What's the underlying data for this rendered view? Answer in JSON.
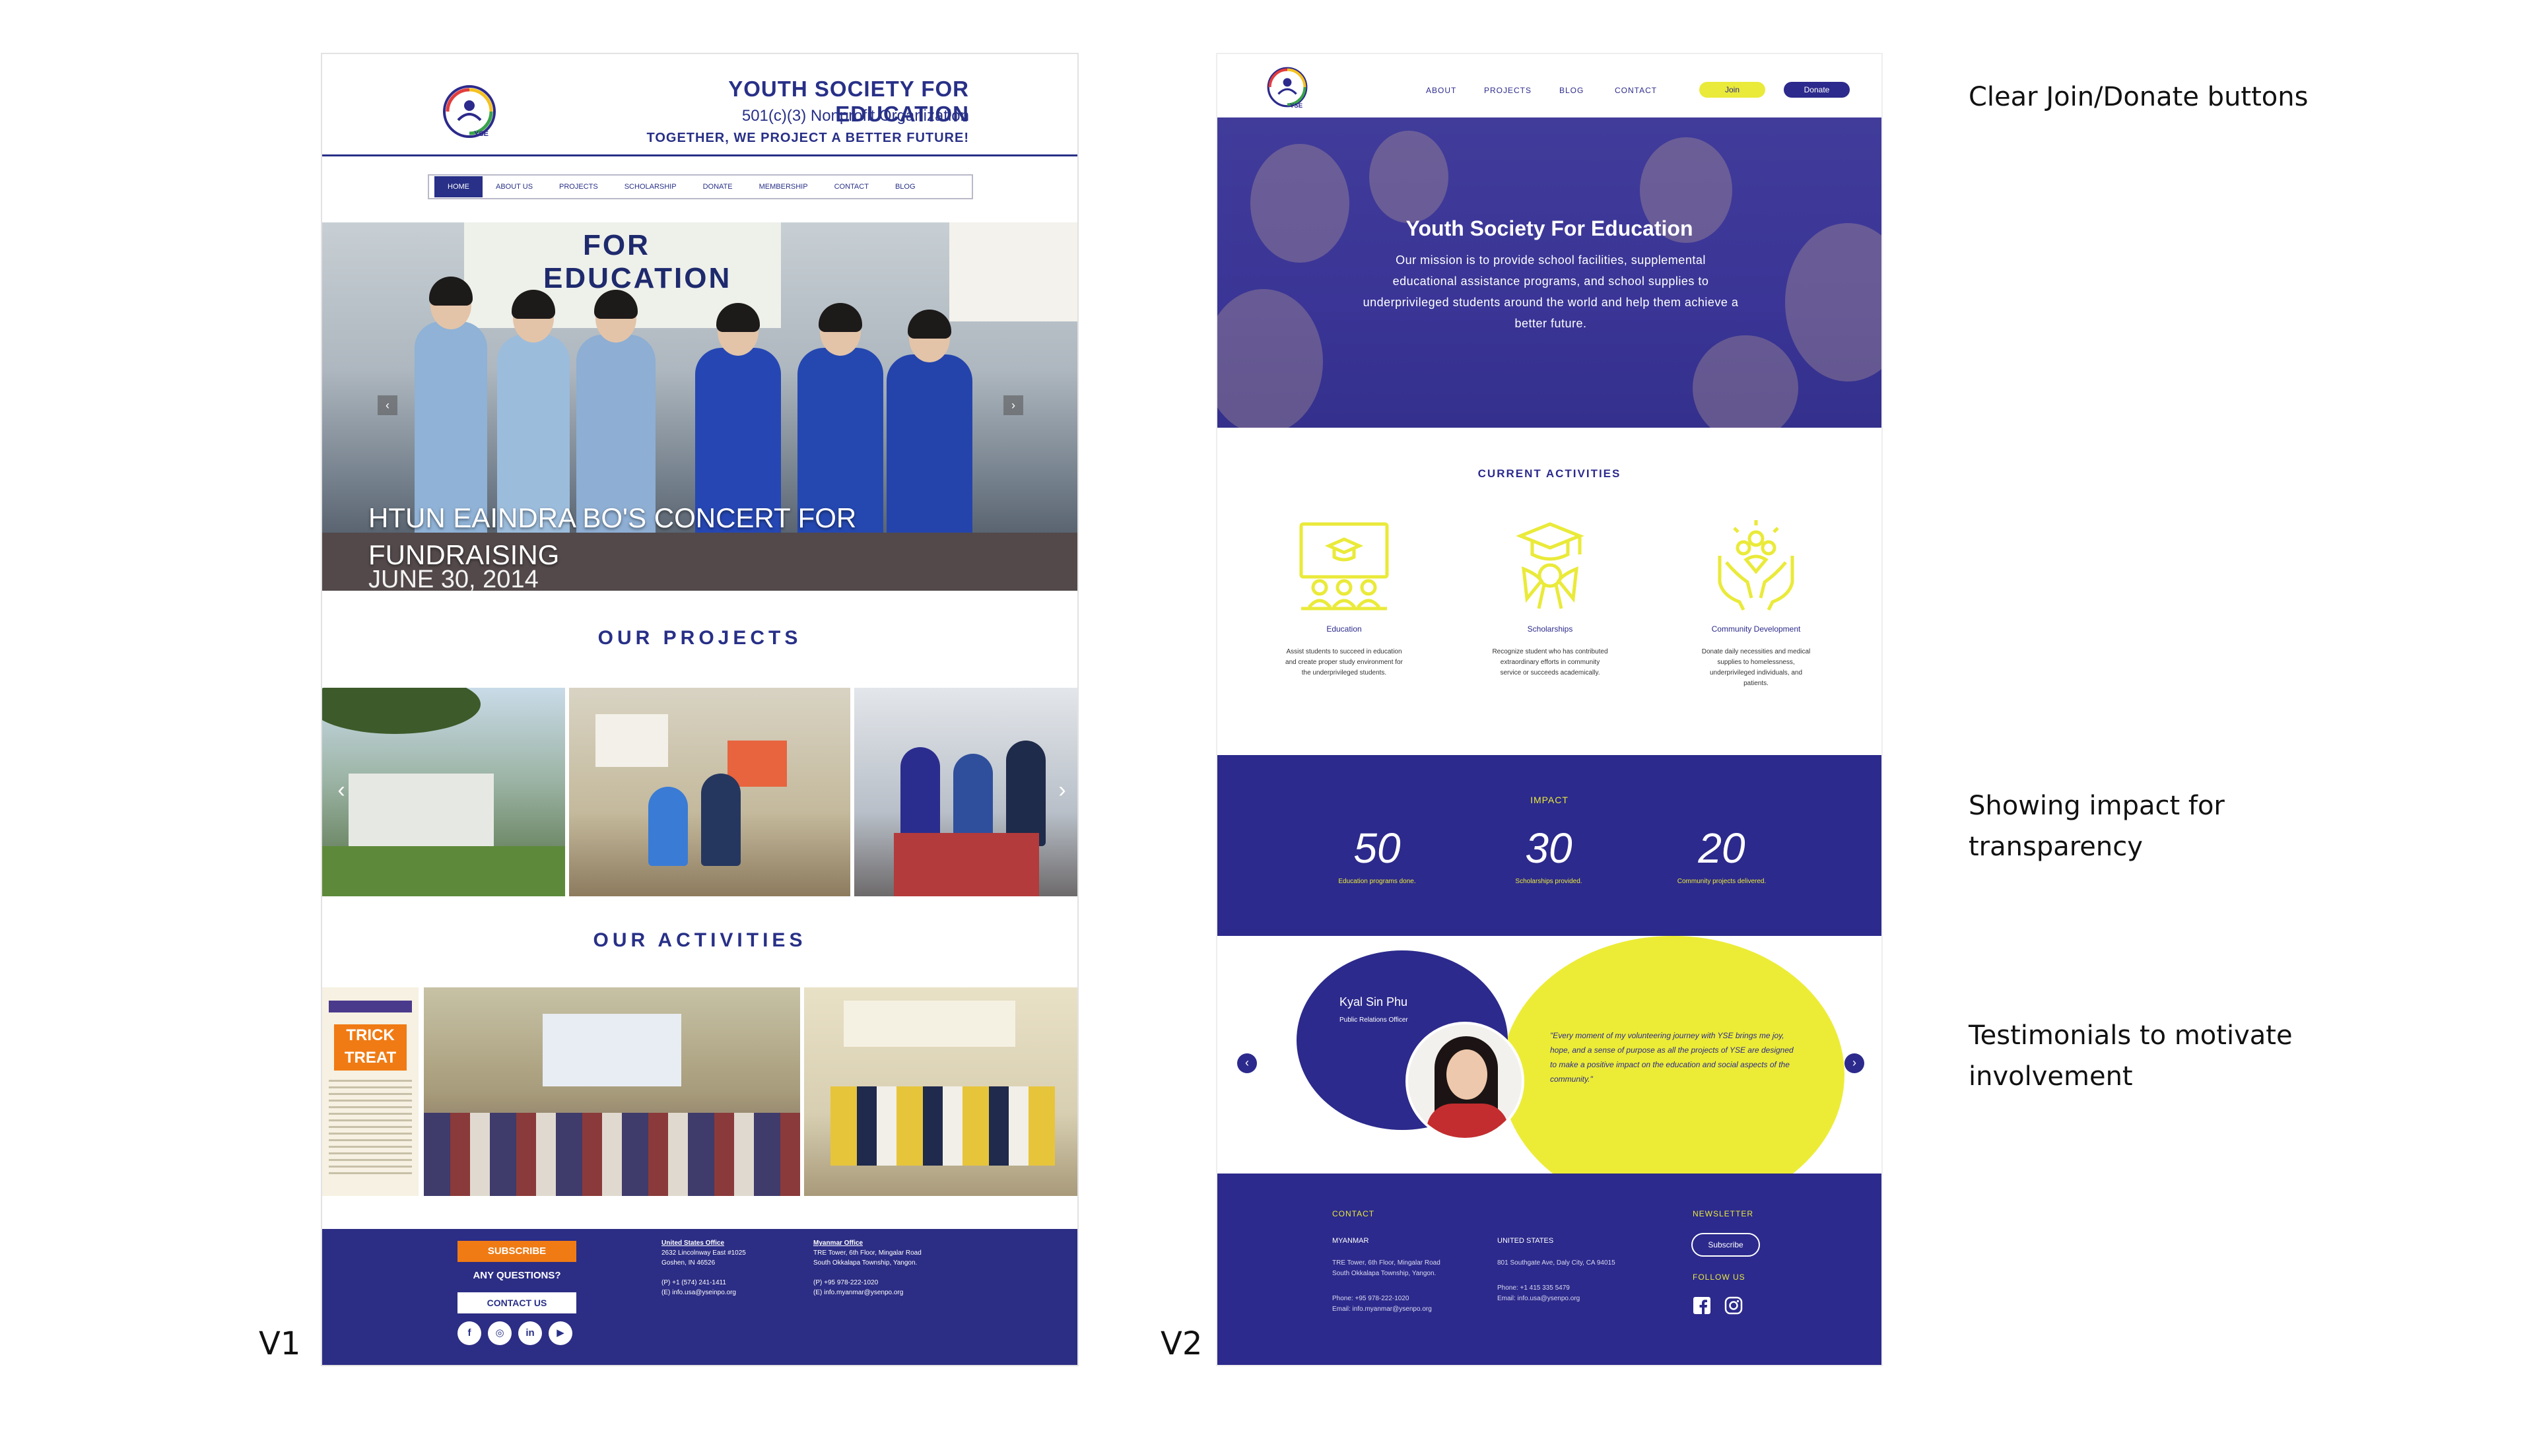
{
  "labels": {
    "v1": "V1",
    "v2": "V2"
  },
  "notes": {
    "buttons": "Clear Join/Donate buttons",
    "impact_line1": "Showing impact for",
    "impact_line2": "transparency",
    "testimonials_line1": "Testimonials to motivate",
    "testimonials_line2": "involvement"
  },
  "v1": {
    "org_title": "YOUTH SOCIETY FOR EDUCATION",
    "org_subtitle": "501(c)(3) Nonprofit Organization",
    "org_tagline": "TOGETHER, WE PROJECT A BETTER FUTURE!",
    "logo_text": "YSE",
    "nav": [
      "HOME",
      "ABOUT US",
      "PROJECTS",
      "SCHOLARSHIP",
      "DONATE",
      "MEMBERSHIP",
      "CONTACT",
      "BLOG"
    ],
    "hero": {
      "banner_line1": "FOR",
      "banner_line2": "EDUCATION",
      "title_line1": "HTUN EAINDRA BO'S CONCERT FOR",
      "title_line2": "FUNDRAISING",
      "date": "JUNE 30, 2014"
    },
    "projects_title": "OUR PROJECTS",
    "activities_title": "OUR ACTIVITIES",
    "poster_text": "TRICK TREAT",
    "footer": {
      "subscribe": "SUBSCRIBE",
      "questions": "ANY QUESTIONS?",
      "contact": "CONTACT US",
      "social": [
        "f",
        "◎",
        "in",
        "▶"
      ],
      "us_office": {
        "title": "United States Office",
        "line1": "2632 Lincolnway East #1025",
        "line2": "Goshen, IN 46526",
        "phone": "(P) +1 (574) 241-1411",
        "email": "(E) info.usa@yseinpo.org"
      },
      "mm_office": {
        "title": "Myanmar Office",
        "line1": "TRE Tower, 6th Floor, Mingalar Road",
        "line2": "South Okkalapa Township, Yangon.",
        "phone": "(P) +95 978-222-1020",
        "email": "(E) info.myanmar@ysenpo.org"
      }
    }
  },
  "v2": {
    "logo_text": "YSE",
    "nav": [
      "ABOUT",
      "PROJECTS",
      "BLOG",
      "CONTACT"
    ],
    "join": "Join",
    "donate": "Donate",
    "hero_title": "Youth Society For Education",
    "hero_text": "Our mission is to provide school facilities, supplemental educational assistance programs, and school supplies to underprivileged students around the world and help them achieve a better future.",
    "current_activities": "CURRENT ACTIVITIES",
    "activities": [
      {
        "title": "Education",
        "desc": "Assist students to succeed in education and create proper study environment for the underprivileged students.",
        "icon": "classroom-icon"
      },
      {
        "title": "Scholarships",
        "desc": "Recognize student who has contributed extraordinary efforts in community service or succeeds academically.",
        "icon": "graduation-icon"
      },
      {
        "title": "Community Development",
        "desc": "Donate daily necessities and medical supplies to homelessness, underprivileged individuals, and patients.",
        "icon": "hands-heart-icon"
      }
    ],
    "impact": {
      "title": "IMPACT",
      "stats": [
        {
          "value": "50",
          "label": "Education programs done."
        },
        {
          "value": "30",
          "label": "Scholarships provided."
        },
        {
          "value": "20",
          "label": "Community projects delivered."
        }
      ]
    },
    "testimonial": {
      "name": "Kyal Sin Phu",
      "role": "Public Relations Officer",
      "quote": "\"Every moment of my volunteering journey with YSE brings me joy, hope, and a sense of purpose as all the projects of YSE are designed to make a positive impact on the education and social aspects of the community.\""
    },
    "footer": {
      "contact": "CONTACT",
      "myanmar": "MYANMAR",
      "mm_line1": "TRE Tower, 6th Floor, Mingalar Road",
      "mm_line2": "South Okkalapa Township, Yangon.",
      "mm_phone": "Phone: +95 978-222-1020",
      "mm_email": "Email: info.myanmar@ysenpo.org",
      "us": "UNITED STATES",
      "us_line1": "801 Southgate Ave, Daly City, CA 94015",
      "us_phone": "Phone: +1 415 335 5479",
      "us_email": "Email: info.usa@ysenpo.org",
      "newsletter": "NEWSLETTER",
      "subscribe": "Subscribe",
      "follow": "FOLLOW US"
    }
  },
  "colors": {
    "v1_navy": "#283087",
    "v1_orange": "#f07b14",
    "v2_indigo": "#2c2a8c",
    "v2_yellow": "#eaea3a"
  }
}
